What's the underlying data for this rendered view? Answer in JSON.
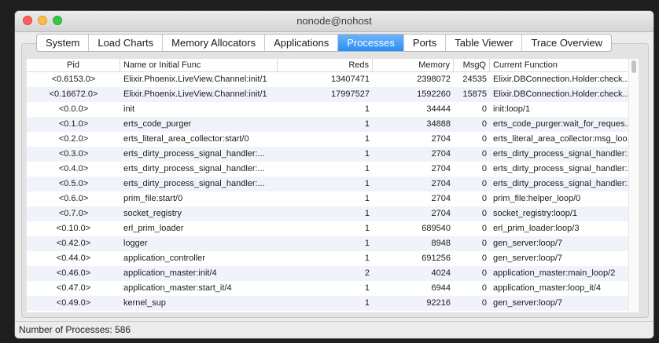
{
  "window": {
    "title": "nonode@nohost"
  },
  "tabs": [
    {
      "label": "System",
      "active": false
    },
    {
      "label": "Load Charts",
      "active": false
    },
    {
      "label": "Memory Allocators",
      "active": false
    },
    {
      "label": "Applications",
      "active": false
    },
    {
      "label": "Processes",
      "active": true
    },
    {
      "label": "Ports",
      "active": false
    },
    {
      "label": "Table Viewer",
      "active": false
    },
    {
      "label": "Trace Overview",
      "active": false
    }
  ],
  "table": {
    "columns": [
      "Pid",
      "Name or Initial Func",
      "Reds",
      "Memory",
      "MsgQ",
      "Current Function"
    ],
    "rows": [
      [
        "<0.6153.0>",
        "Elixir.Phoenix.LiveView.Channel:init/1",
        "13407471",
        "2398072",
        "24535",
        "Elixir.DBConnection.Holder:check..."
      ],
      [
        "<0.16672.0>",
        "Elixir.Phoenix.LiveView.Channel:init/1",
        "17997527",
        "1592260",
        "15875",
        "Elixir.DBConnection.Holder:check..."
      ],
      [
        "<0.0.0>",
        "init",
        "1",
        "34444",
        "0",
        "init:loop/1"
      ],
      [
        "<0.1.0>",
        "erts_code_purger",
        "1",
        "34888",
        "0",
        "erts_code_purger:wait_for_reques..."
      ],
      [
        "<0.2.0>",
        "erts_literal_area_collector:start/0",
        "1",
        "2704",
        "0",
        "erts_literal_area_collector:msg_loo..."
      ],
      [
        "<0.3.0>",
        "erts_dirty_process_signal_handler:...",
        "1",
        "2704",
        "0",
        "erts_dirty_process_signal_handler:..."
      ],
      [
        "<0.4.0>",
        "erts_dirty_process_signal_handler:...",
        "1",
        "2704",
        "0",
        "erts_dirty_process_signal_handler:..."
      ],
      [
        "<0.5.0>",
        "erts_dirty_process_signal_handler:...",
        "1",
        "2704",
        "0",
        "erts_dirty_process_signal_handler:..."
      ],
      [
        "<0.6.0>",
        "prim_file:start/0",
        "1",
        "2704",
        "0",
        "prim_file:helper_loop/0"
      ],
      [
        "<0.7.0>",
        "socket_registry",
        "1",
        "2704",
        "0",
        "socket_registry:loop/1"
      ],
      [
        "<0.10.0>",
        "erl_prim_loader",
        "1",
        "689540",
        "0",
        "erl_prim_loader:loop/3"
      ],
      [
        "<0.42.0>",
        "logger",
        "1",
        "8948",
        "0",
        "gen_server:loop/7"
      ],
      [
        "<0.44.0>",
        "application_controller",
        "1",
        "691256",
        "0",
        "gen_server:loop/7"
      ],
      [
        "<0.46.0>",
        "application_master:init/4",
        "2",
        "4024",
        "0",
        "application_master:main_loop/2"
      ],
      [
        "<0.47.0>",
        "application_master:start_it/4",
        "1",
        "6944",
        "0",
        "application_master:loop_it/4"
      ],
      [
        "<0.49.0>",
        "kernel_sup",
        "1",
        "92216",
        "0",
        "gen_server:loop/7"
      ]
    ]
  },
  "status": {
    "text": "Number of Processes: 586"
  }
}
